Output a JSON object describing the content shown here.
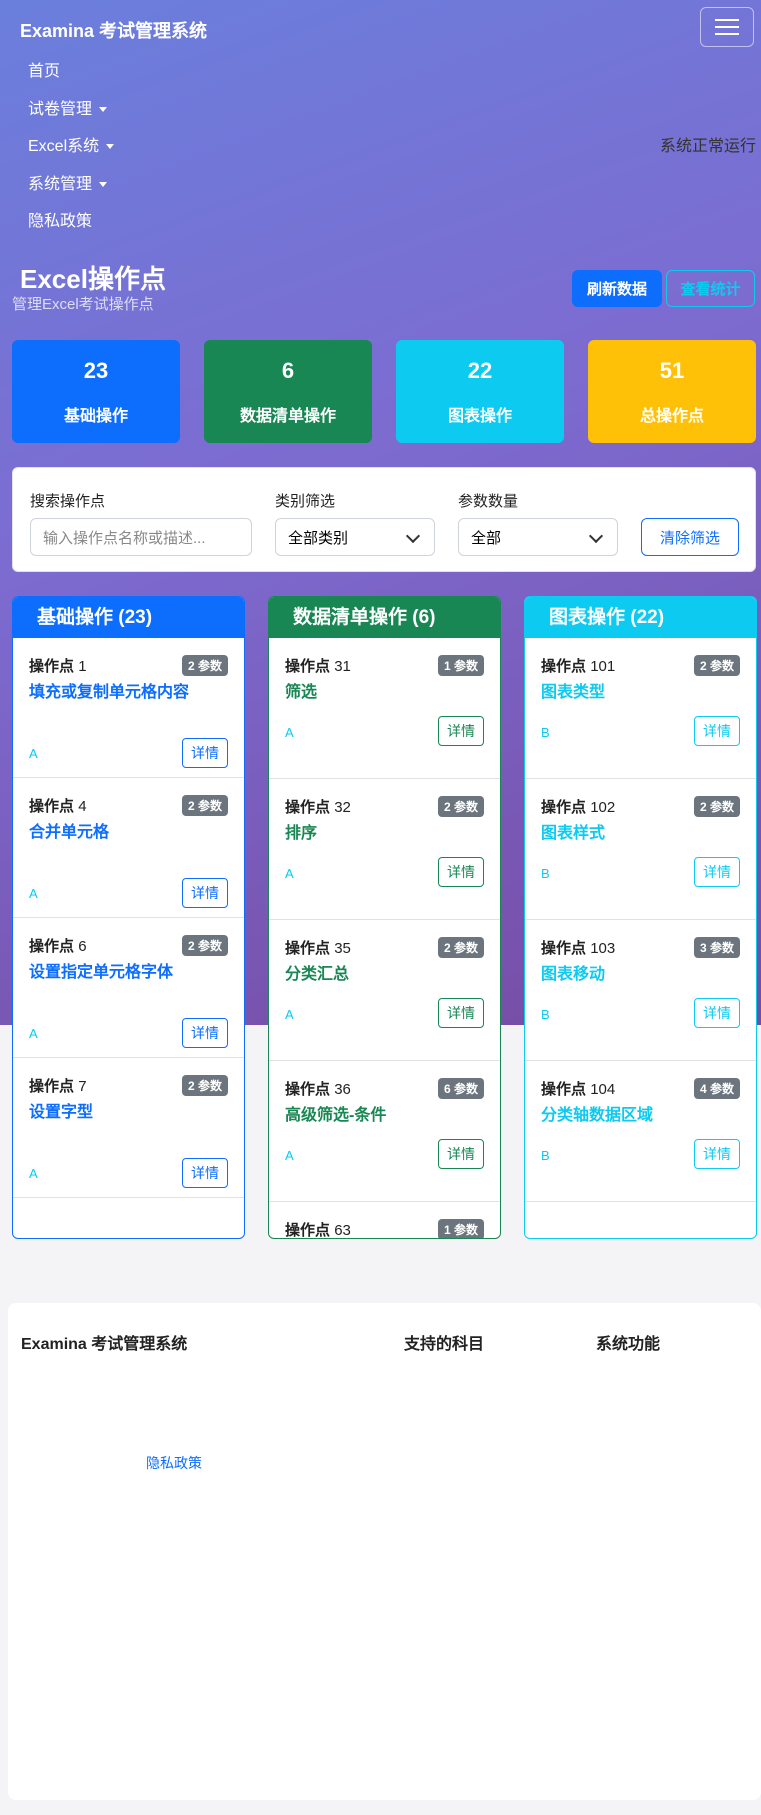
{
  "brand": "Examina 考试管理系统",
  "nav": {
    "home": "首页",
    "papers": "试卷管理",
    "excel": "Excel系统",
    "system": "系统管理",
    "privacy": "隐私政策"
  },
  "status_text": "系统正常运行",
  "page": {
    "title": "Excel操作点",
    "subtitle": "管理Excel考试操作点",
    "refresh_label": "刷新数据",
    "stats_label": "查看统计"
  },
  "stats": [
    {
      "value": "23",
      "label": "基础操作",
      "color": "#0d6efd"
    },
    {
      "value": "6",
      "label": "数据清单操作",
      "color": "#198754"
    },
    {
      "value": "22",
      "label": "图表操作",
      "color": "#0dcaf0"
    },
    {
      "value": "51",
      "label": "总操作点",
      "color": "#ffc107"
    }
  ],
  "filters": {
    "search_label": "搜索操作点",
    "search_placeholder": "输入操作点名称或描述...",
    "category_label": "类别筛选",
    "category_value": "全部类别",
    "params_label": "参数数量",
    "params_value": "全部",
    "clear_label": "清除筛选"
  },
  "columns": [
    {
      "title": "基础操作 (23)",
      "color": "#0d6efd",
      "items": [
        {
          "prefix": "操作点",
          "num": "1",
          "params": "2 参数",
          "name": "填充或复制单元格内容",
          "cat": "A",
          "detail": "详情"
        },
        {
          "prefix": "操作点",
          "num": "4",
          "params": "2 参数",
          "name": "合并单元格",
          "cat": "A",
          "detail": "详情"
        },
        {
          "prefix": "操作点",
          "num": "6",
          "params": "2 参数",
          "name": "设置指定单元格字体",
          "cat": "A",
          "detail": "详情"
        },
        {
          "prefix": "操作点",
          "num": "7",
          "params": "2 参数",
          "name": "设置字型",
          "cat": "A",
          "detail": "详情"
        }
      ]
    },
    {
      "title": "数据清单操作 (6)",
      "color": "#198754",
      "items": [
        {
          "prefix": "操作点",
          "num": "31",
          "params": "1 参数",
          "name": "筛选",
          "cat": "A",
          "detail": "详情"
        },
        {
          "prefix": "操作点",
          "num": "32",
          "params": "2 参数",
          "name": "排序",
          "cat": "A",
          "detail": "详情"
        },
        {
          "prefix": "操作点",
          "num": "35",
          "params": "2 参数",
          "name": "分类汇总",
          "cat": "A",
          "detail": "详情"
        },
        {
          "prefix": "操作点",
          "num": "36",
          "params": "6 参数",
          "name": "高级筛选-条件",
          "cat": "A",
          "detail": "详情"
        },
        {
          "prefix": "操作点",
          "num": "63",
          "params": "1 参数",
          "name": "",
          "cat": "",
          "detail": ""
        }
      ]
    },
    {
      "title": "图表操作 (22)",
      "color": "#0dcaf0",
      "items": [
        {
          "prefix": "操作点",
          "num": "101",
          "params": "2 参数",
          "name": "图表类型",
          "cat": "B",
          "detail": "详情"
        },
        {
          "prefix": "操作点",
          "num": "102",
          "params": "2 参数",
          "name": "图表样式",
          "cat": "B",
          "detail": "详情"
        },
        {
          "prefix": "操作点",
          "num": "103",
          "params": "3 参数",
          "name": "图表移动",
          "cat": "B",
          "detail": "详情"
        },
        {
          "prefix": "操作点",
          "num": "104",
          "params": "4 参数",
          "name": "分类轴数据区域",
          "cat": "B",
          "detail": "详情"
        }
      ]
    }
  ],
  "footer": {
    "brand": "Examina 考试管理系统",
    "subjects_heading": "支持的科目",
    "features_heading": "系统功能",
    "privacy_link": "隐私政策"
  }
}
